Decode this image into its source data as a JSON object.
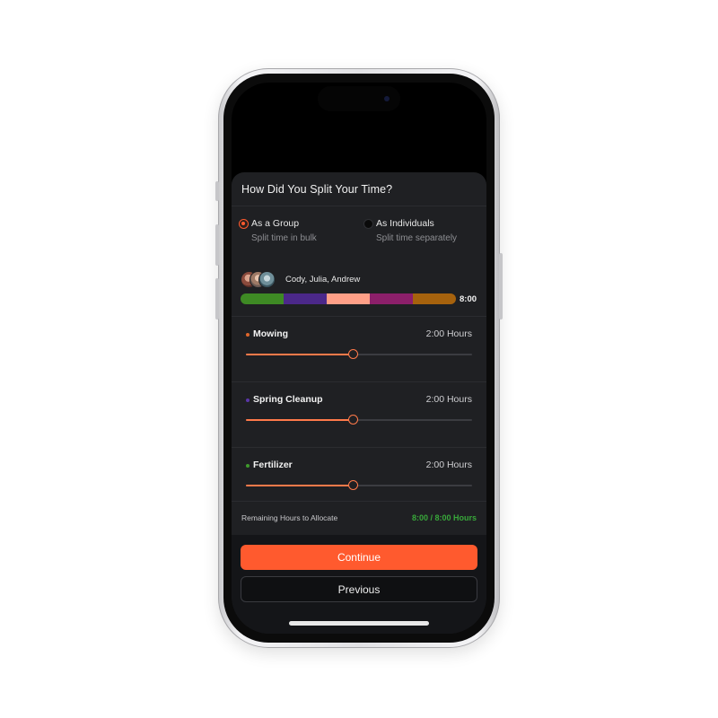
{
  "sheet": {
    "title": "How Did You Split Your Time?"
  },
  "split_options": [
    {
      "title": "As a Group",
      "subtitle": "Split time in bulk",
      "selected": true
    },
    {
      "title": "As Individuals",
      "subtitle": "Split time separately",
      "selected": false
    }
  ],
  "crew": {
    "names": "Cody, Julia, Andrew",
    "total": "8:00",
    "bar_segments": [
      {
        "color": "#3e8a24",
        "share": 0.2
      },
      {
        "color": "#4b2889",
        "share": 0.2
      },
      {
        "color": "#ff9f87",
        "share": 0.2
      },
      {
        "color": "#8c1f6a",
        "share": 0.2
      },
      {
        "color": "#a6620d",
        "share": 0.2
      }
    ]
  },
  "tasks": [
    {
      "name": "Mowing",
      "hours": "2:00 Hours",
      "dot_color": "#e0662b",
      "fraction": 0.476
    },
    {
      "name": "Spring Cleanup",
      "hours": "2:00 Hours",
      "dot_color": "#5a36a8",
      "fraction": 0.476
    },
    {
      "name": "Fertilizer",
      "hours": "2:00 Hours",
      "dot_color": "#3e9a2c",
      "fraction": 0.476
    }
  ],
  "remaining": {
    "label": "Remaining Hours to Allocate",
    "value": "8:00 / 8:00 Hours"
  },
  "actions": {
    "continue_label": "Continue",
    "previous_label": "Previous"
  },
  "colors": {
    "accent": "#ff5a2e",
    "success": "#38a83a",
    "sheet_bg": "#1f2023"
  }
}
